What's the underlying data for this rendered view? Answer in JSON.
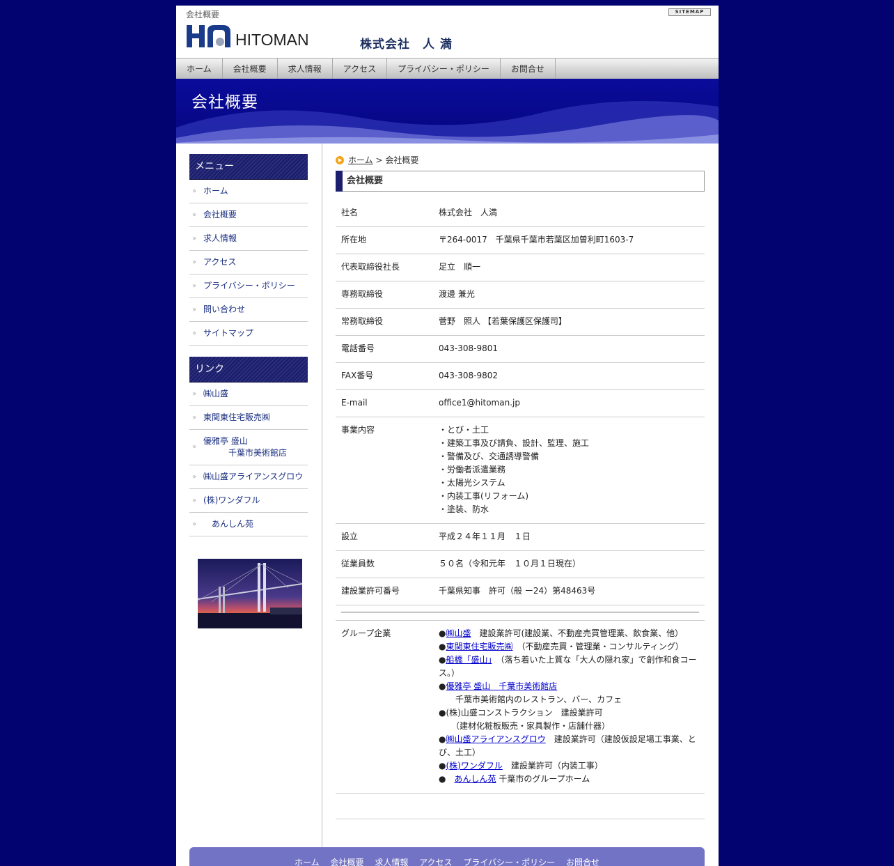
{
  "header": {
    "page_title": "会社概要",
    "sitemap_label": "SITEMAP",
    "logo_text": "HITOMAN",
    "company_name": "株式会社　人 満"
  },
  "gnav": [
    "ホーム",
    "会社概要",
    "求人情報",
    "アクセス",
    "プライバシー・ポリシー",
    "お問合せ"
  ],
  "hero": {
    "title": "会社概要"
  },
  "sidebar": {
    "menu_title": "メニュー",
    "menu_items": [
      "ホーム",
      "会社概要",
      "求人情報",
      "アクセス",
      "プライバシー・ポリシー",
      "問い合わせ",
      "サイトマップ"
    ],
    "links_title": "リンク",
    "link_items": [
      {
        "line1": "㈱山盛",
        "line2": ""
      },
      {
        "line1": "東関東住宅販売㈱",
        "line2": ""
      },
      {
        "line1": "優雅亭 盛山",
        "line2": "千葉市美術館店"
      },
      {
        "line1": "㈱山盛アライアンスグロウ",
        "line2": ""
      },
      {
        "line1": "(株)ワンダフル",
        "line2": ""
      },
      {
        "line1": "　あんしん苑",
        "line2": ""
      }
    ]
  },
  "breadcrumb": {
    "home": "ホーム",
    "sep": " > ",
    "current": "会社概要"
  },
  "heading": "会社概要",
  "info": [
    {
      "label": "社名",
      "value": "株式会社　人満"
    },
    {
      "label": "所在地",
      "value": "〒264-0017　千葉県千葉市若葉区加曽利町1603-7"
    },
    {
      "label": "代表取締役社長",
      "value": "足立　順一"
    },
    {
      "label": "専務取締役",
      "value": "渡邊 兼光"
    },
    {
      "label": "常務取締役",
      "value": "菅野　照人 【若葉保護区保護司】"
    },
    {
      "label": "電話番号",
      "value": "043-308-9801"
    },
    {
      "label": "FAX番号",
      "value": "043-308-9802"
    },
    {
      "label": "E-mail",
      "value": "office1@hitoman.jp"
    }
  ],
  "business": {
    "label": "事業内容",
    "items": [
      "・とび・土工",
      "・建築工事及び請負、設計、監理、施工",
      "・警備及び、交通誘導警備",
      "・労働者派遣業務",
      "・太陽光システム",
      "・内装工事(リフォーム)",
      "・塗装、防水"
    ]
  },
  "info2": [
    {
      "label": "設立",
      "value": "平成２４年１１月　１日"
    },
    {
      "label": "従業員数",
      "value": "５０名（令和元年　１０月１日現在）"
    },
    {
      "label": "建設業許可番号",
      "value": "千葉県知事　許可（般 ー24）第48463号"
    }
  ],
  "group": {
    "label": "グループ企業",
    "g1": {
      "bullet": "●",
      "link": "㈱山盛",
      "text": "　建設業許可(建設業、不動産売買管理業、飲食業、他）"
    },
    "g2": {
      "bullet": "●",
      "link": "東関東住宅販売㈱",
      "text": "　（不動産売買・管理業・コンサルティング）"
    },
    "g3": {
      "bullet": "●",
      "link": "船橋「盛山」",
      "text": "　（落ち着いた上質な「大人の隠れ家」で創作和食コース。）"
    },
    "g4": {
      "bullet": "●",
      "link": "優雅亭 盛山　千葉市美術館店",
      "sub": "　　千葉市美術館内のレストラン、バー、カフェ"
    },
    "g5": {
      "text": "●(株)山盛コンストラクション　建設業許可",
      "sub": "　　（建材化粧板販売・家具製作・店舗什器）"
    },
    "g6": {
      "bullet": "●",
      "link": "㈱山盛アライアンスグロウ",
      "text": "　建設業許可（建設仮設足場工事業、とび、土工）"
    },
    "g7": {
      "bullet": "●",
      "link": "(株)ワンダフル",
      "text": "　建設業許可（内装工事）"
    },
    "g8": {
      "bullet": "●　",
      "link": "あんしん苑",
      "text": " 千葉市のグループホーム"
    }
  },
  "footer": [
    "ホーム",
    "会社概要",
    "求人情報",
    "アクセス",
    "プライバシー・ポリシー",
    "お問合せ"
  ]
}
